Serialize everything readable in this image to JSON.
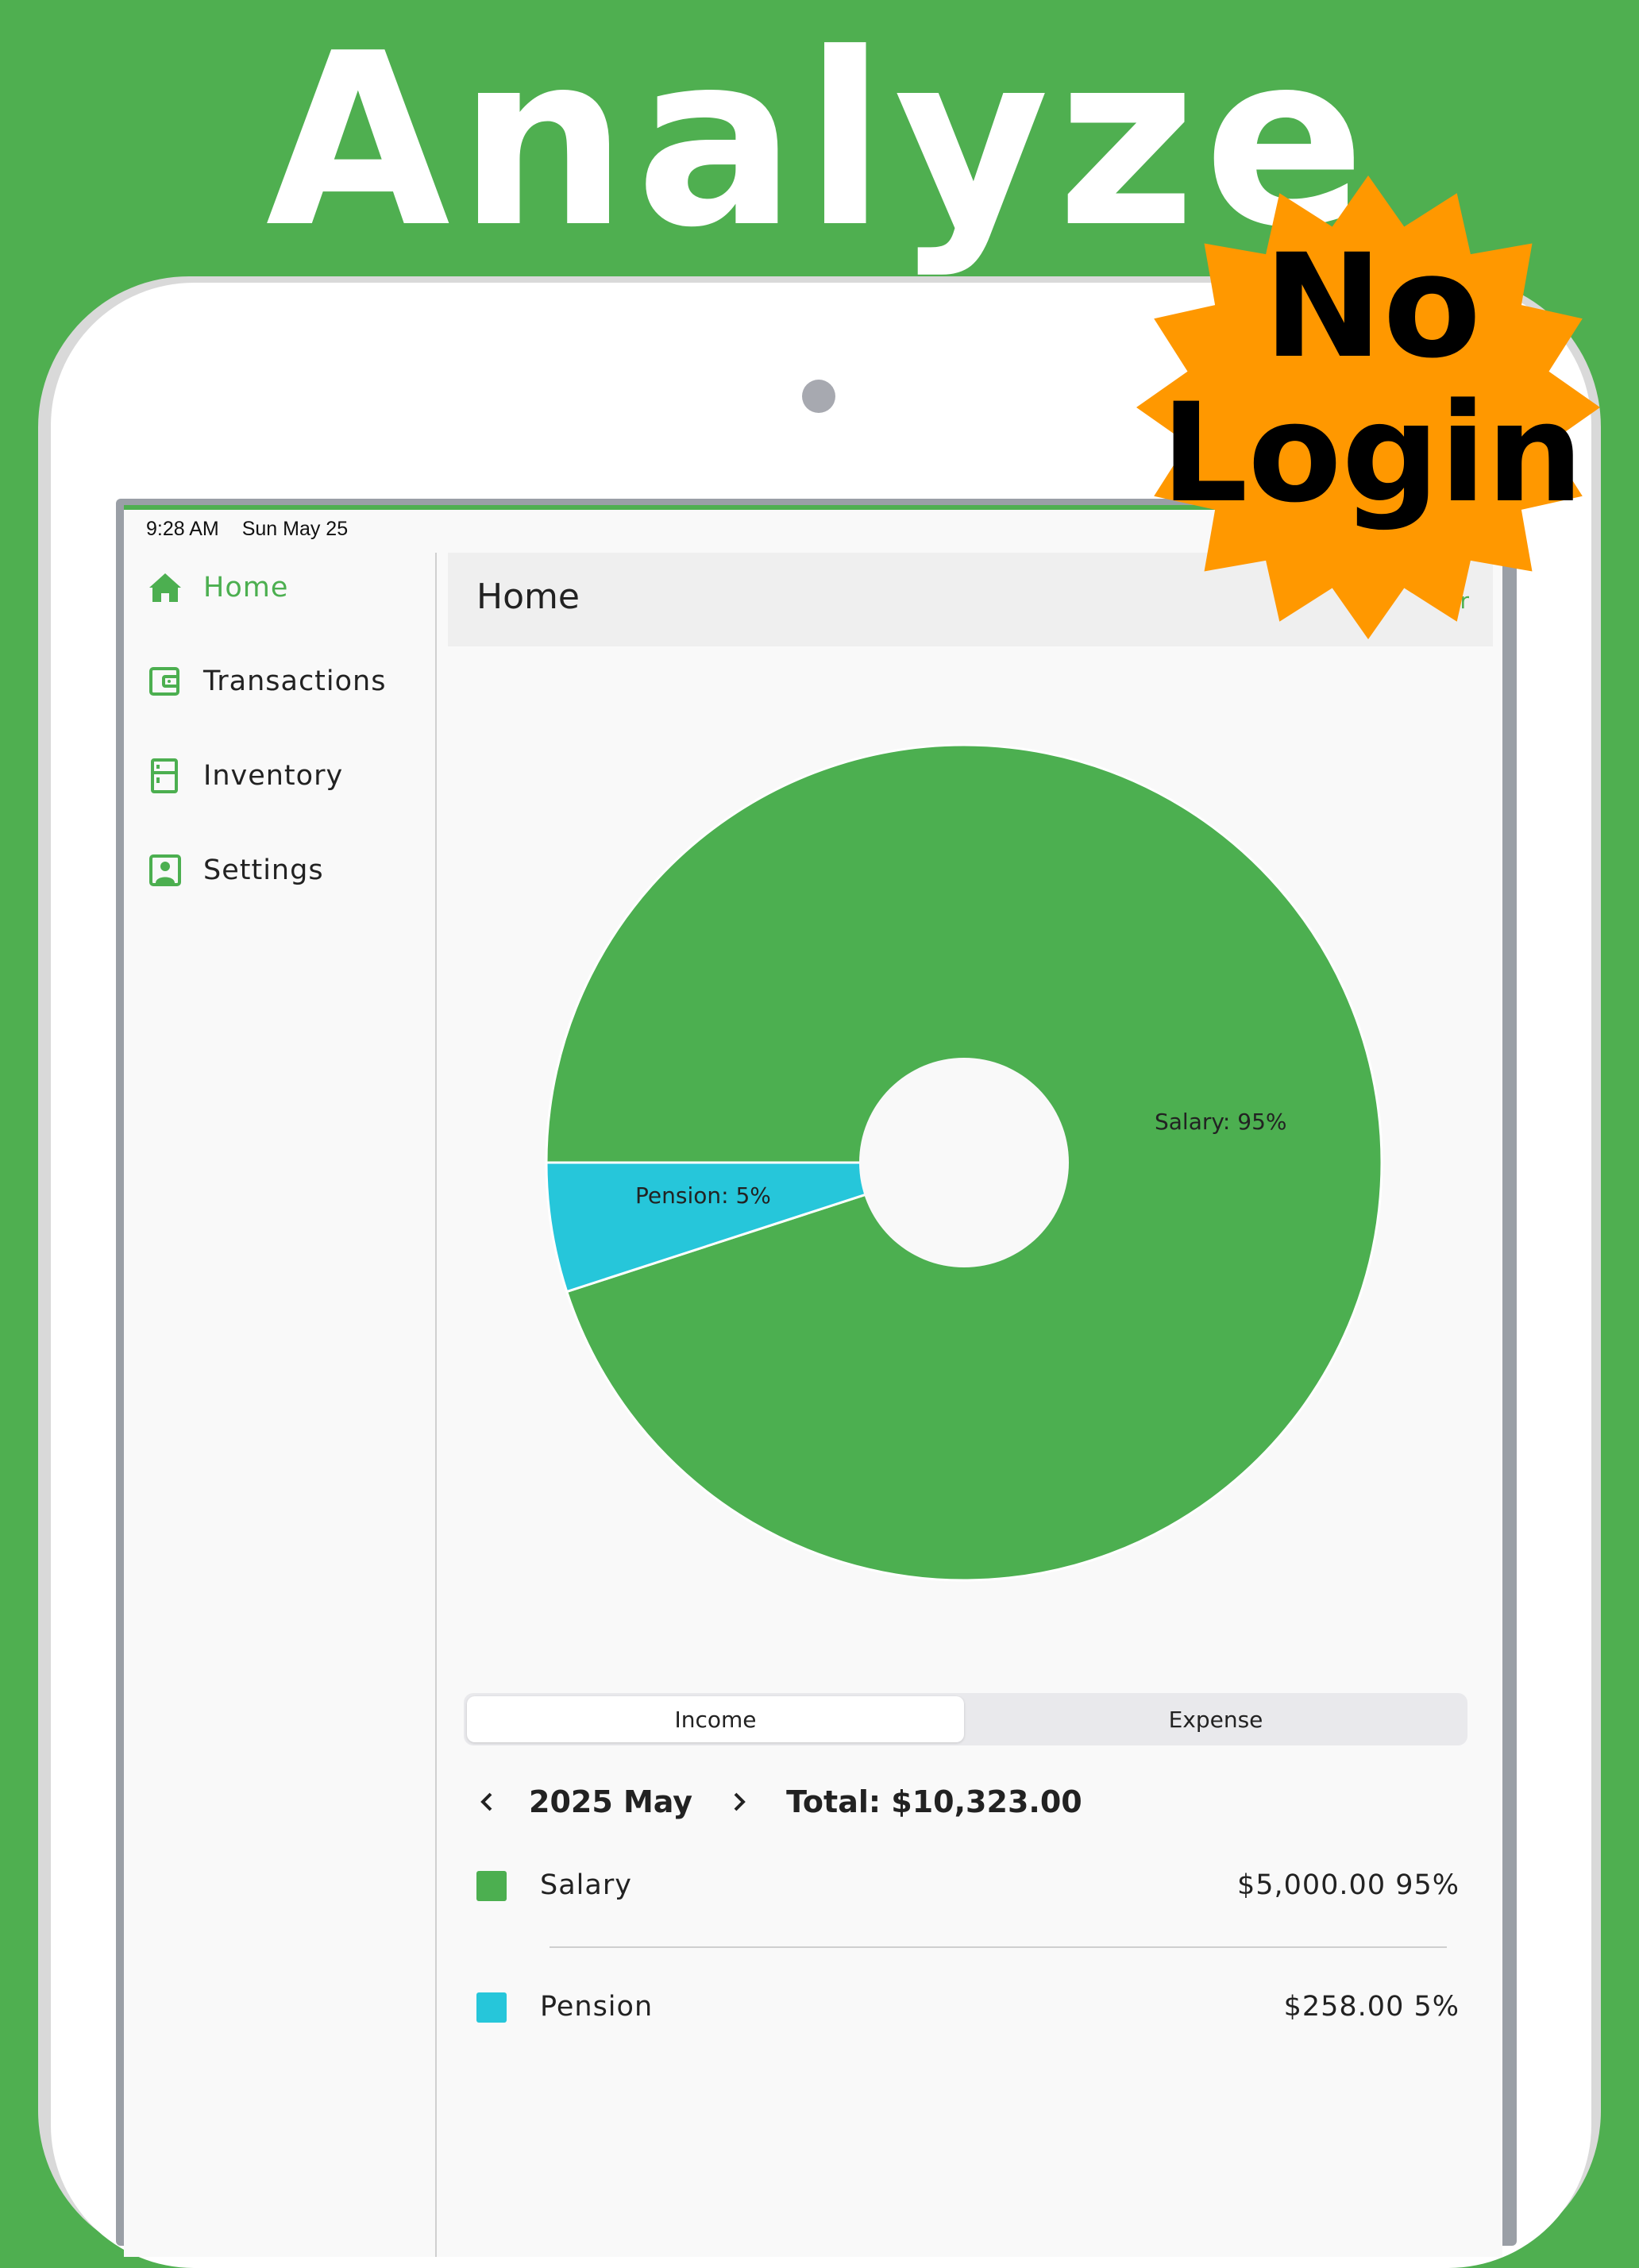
{
  "headline": "Analyze",
  "badge": {
    "line1": "No",
    "line2": "Login",
    "color": "#ff9800"
  },
  "status_bar": {
    "time": "9:28 AM",
    "date": "Sun May 25"
  },
  "sidebar": {
    "items": [
      {
        "label": "Home",
        "icon": "home-icon",
        "active": true
      },
      {
        "label": "Transactions",
        "icon": "wallet-icon",
        "active": false
      },
      {
        "label": "Inventory",
        "icon": "cabinet-icon",
        "active": false
      },
      {
        "label": "Settings",
        "icon": "account-icon",
        "active": false
      }
    ]
  },
  "header": {
    "title": "Home",
    "action_label": "ear"
  },
  "chart_data": {
    "type": "pie",
    "donut": true,
    "slices": [
      {
        "label": "Salary: 95%",
        "name": "Salary",
        "value": 95,
        "color": "#4caf50"
      },
      {
        "label": "Pension: 5%",
        "name": "Pension",
        "value": 5,
        "color": "#26c6da"
      }
    ]
  },
  "segmented": {
    "income_label": "Income",
    "expense_label": "Expense",
    "selected": "Income"
  },
  "period": {
    "month": "2025 May",
    "total": "Total: $10,323.00"
  },
  "list": [
    {
      "name": "Salary",
      "amount": "$5,000.00 95%",
      "color": "#4caf50"
    },
    {
      "name": "Pension",
      "amount": "$258.00 5%",
      "color": "#26c6da"
    }
  ],
  "colors": {
    "brand_green": "#4caf50",
    "pension_cyan": "#26c6da",
    "background_green": "#4faf50"
  }
}
